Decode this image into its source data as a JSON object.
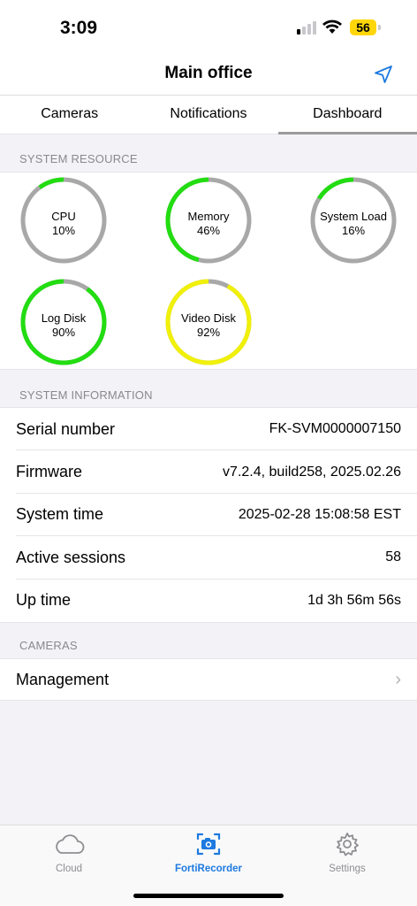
{
  "status_bar": {
    "time": "3:09",
    "battery": "56",
    "signal_bars_active": 1,
    "signal_bars_total": 4
  },
  "nav": {
    "title": "Main office",
    "location_icon": "location-arrow-icon"
  },
  "tabs": [
    {
      "label": "Cameras",
      "active": false
    },
    {
      "label": "Notifications",
      "active": false
    },
    {
      "label": "Dashboard",
      "active": true
    }
  ],
  "system_resource": {
    "header": "SYSTEM RESOURCE",
    "gauges": [
      {
        "name": "CPU",
        "value": "10%",
        "percent": 10,
        "color": "#22dd11"
      },
      {
        "name": "Memory",
        "value": "46%",
        "percent": 46,
        "color": "#22dd11"
      },
      {
        "name": "System Load",
        "value": "16%",
        "percent": 16,
        "color": "#22dd11"
      },
      {
        "name": "Log Disk",
        "value": "90%",
        "percent": 90,
        "color": "#22dd11"
      },
      {
        "name": "Video Disk",
        "value": "92%",
        "percent": 92,
        "color": "#f0f00a"
      }
    ],
    "track_color": "#a8a8a8"
  },
  "system_information": {
    "header": "SYSTEM INFORMATION",
    "rows": [
      {
        "label": "Serial number",
        "value": "FK-SVM0000007150"
      },
      {
        "label": "Firmware",
        "value": "v7.2.4, build258, 2025.02.26"
      },
      {
        "label": "System time",
        "value": "2025-02-28 15:08:58 EST"
      },
      {
        "label": "Active sessions",
        "value": "58"
      },
      {
        "label": "Up time",
        "value": "1d 3h 56m 56s"
      }
    ]
  },
  "cameras": {
    "header": "CAMERAS",
    "items": [
      {
        "label": "Management"
      }
    ]
  },
  "tab_bar": {
    "items": [
      {
        "label": "Cloud",
        "icon": "cloud-icon",
        "active": false
      },
      {
        "label": "FortiRecorder",
        "icon": "camera-icon",
        "active": true
      },
      {
        "label": "Settings",
        "icon": "gear-icon",
        "active": false
      }
    ],
    "accent": "#1e7ae0"
  }
}
